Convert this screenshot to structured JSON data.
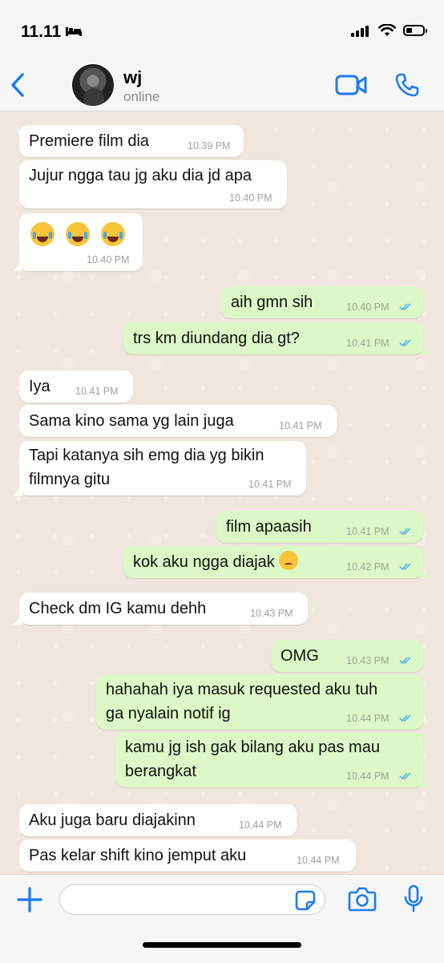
{
  "status": {
    "time": "11.11"
  },
  "contact": {
    "name": "wj",
    "status": "online"
  },
  "colors": {
    "accent": "#1d7af3",
    "incoming": "#ffffff",
    "outgoing": "#dcf8c6",
    "tick": "#4fb6ec"
  },
  "messages": [
    {
      "dir": "in",
      "text": "Premiere film dia",
      "time": "10.39 PM"
    },
    {
      "dir": "in",
      "text": "Jujur ngga tau jg aku dia jd apa",
      "time": "10.40 PM"
    },
    {
      "dir": "in",
      "text": "",
      "emoji": [
        "face-with-tears-of-joy-icon",
        "face-with-tears-of-joy-icon",
        "face-with-tears-of-joy-icon"
      ],
      "time": "10.40 PM"
    },
    {
      "dir": "out",
      "text": "aih gmn sih",
      "time": "10.40 PM"
    },
    {
      "dir": "out",
      "text": "trs km diundang dia gt?",
      "time": "10.41 PM"
    },
    {
      "dir": "in",
      "text": "Iya",
      "time": "10.41 PM"
    },
    {
      "dir": "in",
      "text": "Sama kino sama yg lain juga",
      "time": "10.41 PM"
    },
    {
      "dir": "in",
      "text": "Tapi katanya sih emg dia yg bikin\nfilmnya gitu",
      "time": "10.41 PM"
    },
    {
      "dir": "out",
      "text": "film apaasih",
      "time": "10.41 PM"
    },
    {
      "dir": "out",
      "text": "kok aku ngga diajak",
      "emoji_suffix": "pensive-face-icon",
      "time": "10.42 PM"
    },
    {
      "dir": "in",
      "text": "Check dm IG kamu dehh",
      "time": "10.43 PM"
    },
    {
      "dir": "out",
      "text": "OMG",
      "time": "10.43 PM"
    },
    {
      "dir": "out",
      "text": "hahahah iya masuk requested aku tuh\nga nyalain notif ig",
      "time": "10.44 PM"
    },
    {
      "dir": "out",
      "text": "kamu jg ish gak bilang aku pas mau\nberangkat",
      "time": "10.44 PM"
    },
    {
      "dir": "in",
      "text": "Aku juga baru diajakinn",
      "time": "10.44 PM"
    },
    {
      "dir": "in",
      "text": "Pas kelar shift kino jemput aku",
      "time": "10.44 PM"
    }
  ],
  "composer": {
    "placeholder": ""
  }
}
